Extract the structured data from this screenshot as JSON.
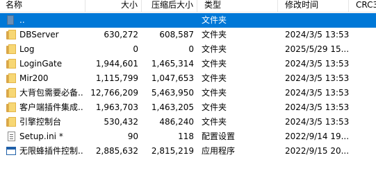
{
  "columns": {
    "name": "名称",
    "size": "大小",
    "packed": "压缩后大小",
    "type": "类型",
    "modified": "修改时间",
    "crc": "CRC3"
  },
  "rows": [
    {
      "icon": "parent-folder-icon",
      "name": "..",
      "size": "",
      "packed": "",
      "type": "文件夹",
      "modified": "",
      "selected": true
    },
    {
      "icon": "folder-icon",
      "name": "DBServer",
      "size": "630,272",
      "packed": "608,587",
      "type": "文件夹",
      "modified": "2024/3/5 13:53"
    },
    {
      "icon": "folder-icon",
      "name": "Log",
      "size": "0",
      "packed": "0",
      "type": "文件夹",
      "modified": "2025/5/29 15..."
    },
    {
      "icon": "folder-icon",
      "name": "LoginGate",
      "size": "1,944,601",
      "packed": "1,465,314",
      "type": "文件夹",
      "modified": "2024/3/5 13:53"
    },
    {
      "icon": "folder-icon",
      "name": "Mir200",
      "size": "1,115,799",
      "packed": "1,047,653",
      "type": "文件夹",
      "modified": "2024/3/5 13:53"
    },
    {
      "icon": "folder-icon",
      "name": "大背包需要必备...",
      "size": "12,766,209",
      "packed": "5,463,950",
      "type": "文件夹",
      "modified": "2024/3/5 13:53"
    },
    {
      "icon": "folder-icon",
      "name": "客户端插件集成...",
      "size": "1,963,703",
      "packed": "1,463,205",
      "type": "文件夹",
      "modified": "2024/3/5 13:53"
    },
    {
      "icon": "folder-icon",
      "name": "引擎控制台",
      "size": "530,432",
      "packed": "486,240",
      "type": "文件夹",
      "modified": "2024/3/5 13:53"
    },
    {
      "icon": "config-file-icon",
      "name": "Setup.ini *",
      "size": "90",
      "packed": "118",
      "type": "配置设置",
      "modified": "2022/9/14 19..."
    },
    {
      "icon": "application-icon",
      "name": "无限蜂插件控制...",
      "size": "2,885,632",
      "packed": "2,815,219",
      "type": "应用程序",
      "modified": "2022/9/15 20..."
    }
  ]
}
